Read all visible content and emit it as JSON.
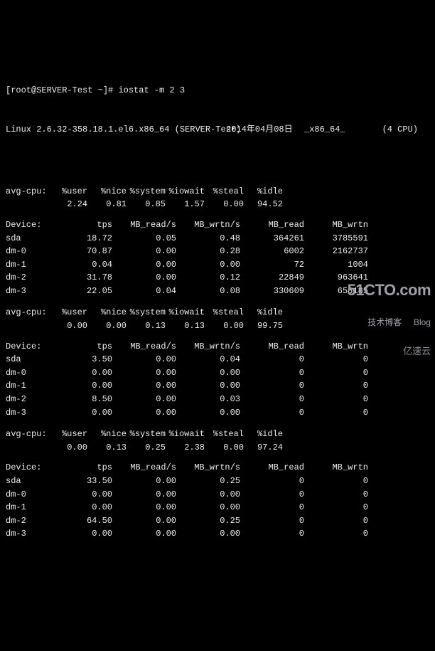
{
  "prompt": {
    "user_host": "[root@SERVER-Test ~]#",
    "cmd": "iostat -m 2 3"
  },
  "sysline": {
    "kernel": "Linux 2.6.32-358.18.1.el6.x86_64 (SERVER-Test)",
    "date": "2014年04月08日",
    "arch": "_x86_64_",
    "cpus": "(4 CPU)"
  },
  "cpu_headers": [
    "avg-cpu:",
    "%user",
    "%nice",
    "%system",
    "%iowait",
    "%steal",
    "%idle"
  ],
  "dev_headers": [
    "Device:",
    "tps",
    "MB_read/s",
    "MB_wrtn/s",
    "MB_read",
    "MB_wrtn"
  ],
  "samples": [
    {
      "cpu": [
        "",
        "2.24",
        "0.81",
        "0.85",
        "1.57",
        "0.00",
        "94.52"
      ],
      "rows": [
        [
          "sda",
          "18.72",
          "0.05",
          "0.48",
          "364261",
          "3785591"
        ],
        [
          "dm-0",
          "70.87",
          "0.00",
          "0.28",
          "6002",
          "2162737"
        ],
        [
          "dm-1",
          "0.04",
          "0.00",
          "0.00",
          "72",
          "1004"
        ],
        [
          "dm-2",
          "31.78",
          "0.00",
          "0.12",
          "22849",
          "963641"
        ],
        [
          "dm-3",
          "22.05",
          "0.04",
          "0.08",
          "330609",
          "658185"
        ]
      ]
    },
    {
      "cpu": [
        "",
        "0.00",
        "0.00",
        "0.13",
        "0.13",
        "0.00",
        "99.75"
      ],
      "rows": [
        [
          "sda",
          "3.50",
          "0.00",
          "0.04",
          "0",
          "0"
        ],
        [
          "dm-0",
          "0.00",
          "0.00",
          "0.00",
          "0",
          "0"
        ],
        [
          "dm-1",
          "0.00",
          "0.00",
          "0.00",
          "0",
          "0"
        ],
        [
          "dm-2",
          "8.50",
          "0.00",
          "0.03",
          "0",
          "0"
        ],
        [
          "dm-3",
          "0.00",
          "0.00",
          "0.00",
          "0",
          "0"
        ]
      ]
    },
    {
      "cpu": [
        "",
        "0.00",
        "0.13",
        "0.25",
        "2.38",
        "0.00",
        "97.24"
      ],
      "rows": [
        [
          "sda",
          "33.50",
          "0.00",
          "0.25",
          "0",
          "0"
        ],
        [
          "dm-0",
          "0.00",
          "0.00",
          "0.00",
          "0",
          "0"
        ],
        [
          "dm-1",
          "0.00",
          "0.00",
          "0.00",
          "0",
          "0"
        ],
        [
          "dm-2",
          "64.50",
          "0.00",
          "0.25",
          "0",
          "0"
        ],
        [
          "dm-3",
          "0.00",
          "0.00",
          "0.00",
          "0",
          "0"
        ]
      ]
    }
  ],
  "watermark": {
    "line1": "51CTO.com",
    "line2": "技术博客     Blog",
    "brand": "亿速云"
  }
}
